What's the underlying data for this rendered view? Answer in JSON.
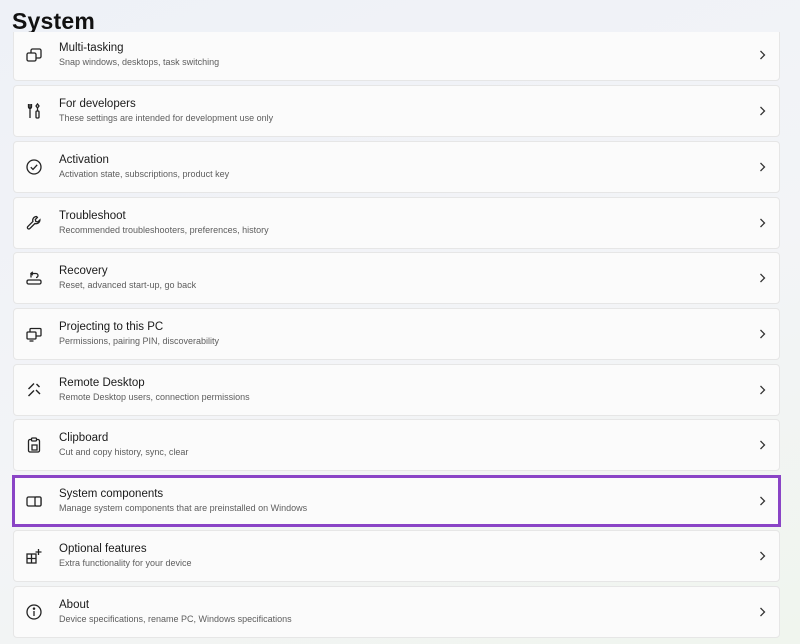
{
  "page": {
    "title": "System"
  },
  "items": [
    {
      "title": "Multi-tasking",
      "desc": "Snap windows, desktops, task switching",
      "icon": "multitasking-icon"
    },
    {
      "title": "For developers",
      "desc": "These settings are intended for development use only",
      "icon": "developer-tools-icon"
    },
    {
      "title": "Activation",
      "desc": "Activation state, subscriptions, product key",
      "icon": "checkmark-circle-icon"
    },
    {
      "title": "Troubleshoot",
      "desc": "Recommended troubleshooters, preferences, history",
      "icon": "wrench-icon"
    },
    {
      "title": "Recovery",
      "desc": "Reset, advanced start-up, go back",
      "icon": "recovery-icon"
    },
    {
      "title": "Projecting to this PC",
      "desc": "Permissions, pairing PIN, discoverability",
      "icon": "projecting-icon"
    },
    {
      "title": "Remote Desktop",
      "desc": "Remote Desktop users, connection permissions",
      "icon": "remote-desktop-icon"
    },
    {
      "title": "Clipboard",
      "desc": "Cut and copy history, sync, clear",
      "icon": "clipboard-icon"
    },
    {
      "title": "System components",
      "desc": "Manage system components that are preinstalled on Windows",
      "icon": "system-components-icon"
    },
    {
      "title": "Optional features",
      "desc": "Extra functionality for your device",
      "icon": "optional-features-icon"
    },
    {
      "title": "About",
      "desc": "Device specifications, rename PC, Windows specifications",
      "icon": "info-icon"
    }
  ],
  "highlight": {
    "item": "System components",
    "color": "#8a44c6"
  },
  "colors": {
    "card_bg": "#fbfbfb",
    "card_border": "#e6e6e6",
    "text_primary": "#1a1a1a",
    "text_secondary": "#5d5d5d"
  }
}
